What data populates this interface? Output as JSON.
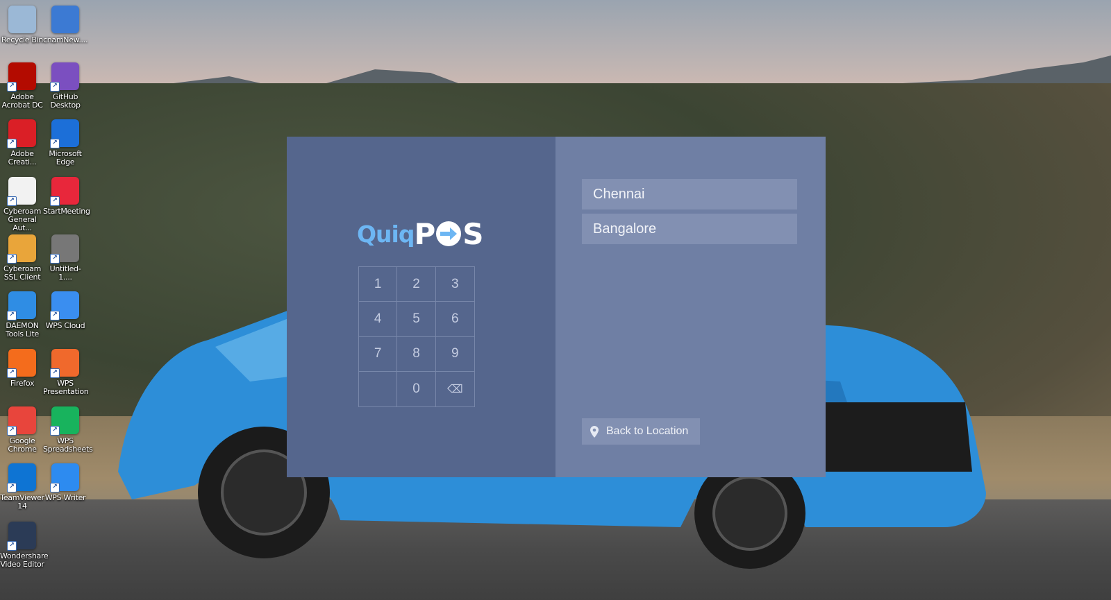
{
  "desktop": {
    "icons": [
      {
        "label": "Recycle Bin",
        "icon": "recycle-bin-icon",
        "color": "#9bb8d6"
      },
      {
        "label": "cnamNew....",
        "icon": "document-icon",
        "color": "#3c7ad3"
      },
      {
        "label": "Adobe Acrobat DC",
        "icon": "acrobat-icon",
        "color": "#b30b00"
      },
      {
        "label": "GitHub Desktop",
        "icon": "github-icon",
        "color": "#7b4fc0"
      },
      {
        "label": "Adobe Creati...",
        "icon": "creative-cloud-icon",
        "color": "#da1f26"
      },
      {
        "label": "Microsoft Edge",
        "icon": "edge-icon",
        "color": "#1c6fd8"
      },
      {
        "label": "Cyberoam General Aut...",
        "icon": "cyberoam-icon",
        "color": "#f2f2f2"
      },
      {
        "label": "StartMeeting",
        "icon": "startmeeting-icon",
        "color": "#e8273b"
      },
      {
        "label": "Cyberoam SSL Client",
        "icon": "cyberoam-ssl-icon",
        "color": "#e9a53a"
      },
      {
        "label": "Untitled-1....",
        "icon": "media-file-icon",
        "color": "#777777"
      },
      {
        "label": "DAEMON Tools Lite",
        "icon": "daemon-tools-icon",
        "color": "#2f8de4"
      },
      {
        "label": "WPS Cloud",
        "icon": "wps-cloud-icon",
        "color": "#3a8ef0"
      },
      {
        "label": "Firefox",
        "icon": "firefox-icon",
        "color": "#f46c1c"
      },
      {
        "label": "WPS Presentation",
        "icon": "wps-presentation-icon",
        "color": "#f0692c"
      },
      {
        "label": "Google Chrome",
        "icon": "chrome-icon",
        "color": "#e8453c"
      },
      {
        "label": "WPS Spreadsheets",
        "icon": "wps-spreadsheets-icon",
        "color": "#18b35d"
      },
      {
        "label": "TeamViewer 14",
        "icon": "teamviewer-icon",
        "color": "#0e74d3"
      },
      {
        "label": "WPS Writer",
        "icon": "wps-writer-icon",
        "color": "#2d8bf0"
      },
      {
        "label": "Wondershare Video Editor",
        "icon": "wondershare-icon",
        "color": "#2b3b56"
      }
    ]
  },
  "app": {
    "logo": {
      "part1": "Quiq",
      "part2": "P",
      "part3": "S"
    },
    "keypad": [
      "1",
      "2",
      "3",
      "4",
      "5",
      "6",
      "7",
      "8",
      "9",
      "",
      "0",
      "⌫"
    ],
    "locations": [
      "Chennai",
      "Bangalore"
    ],
    "back_label": "Back to Location"
  },
  "colors": {
    "left_pane": "#55668d",
    "right_pane": "#6f7fa4",
    "location_bg": "#8290b2",
    "logo_accent": "#6db6f3"
  }
}
